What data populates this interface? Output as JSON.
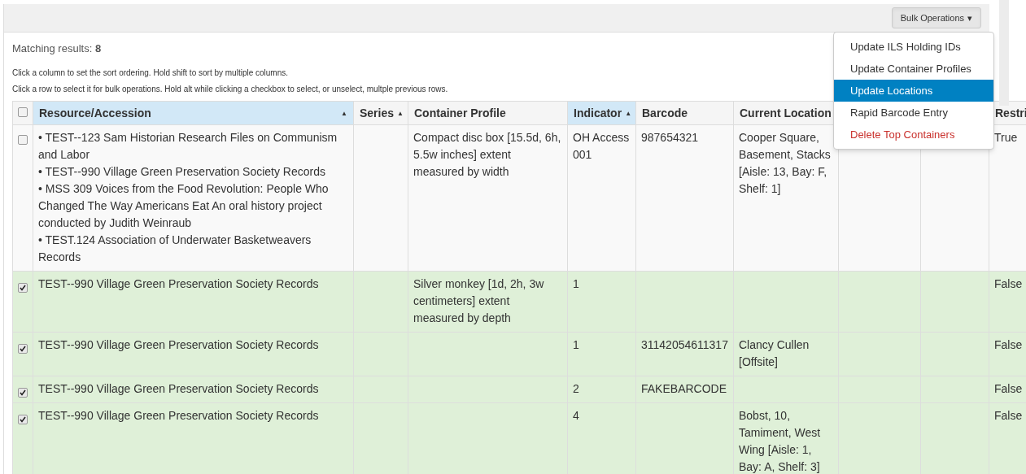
{
  "toolbar": {
    "bulk_button": {
      "label": "Bulk Operations",
      "caret": "▾",
      "expanded": true
    }
  },
  "bulk_menu": [
    {
      "label": "Update ILS Holding IDs",
      "kind": "action",
      "selected": false
    },
    {
      "label": "Update Container Profiles",
      "kind": "action",
      "selected": false
    },
    {
      "label": "Update Locations",
      "kind": "action",
      "selected": true
    },
    {
      "label": "Rapid Barcode Entry",
      "kind": "action",
      "selected": false
    },
    {
      "label": "Delete Top Containers",
      "kind": "danger",
      "selected": false
    }
  ],
  "results": {
    "label": "Matching results:",
    "count": "8"
  },
  "hints": [
    "Click a column to set the sort ordering. Hold shift to sort by multiple columns.",
    "Click a row to select it for bulk operations. Hold alt while clicking a checkbox to select, or unselect, multple previous rows."
  ],
  "table": {
    "select_all": {
      "checked": false
    },
    "columns": [
      {
        "label": "Resource/Accession",
        "sort_icon": "▲",
        "sorted": true
      },
      {
        "label": "Series",
        "sort_icon": "▲",
        "sorted": false
      },
      {
        "label": "Container Profile",
        "sorted": false
      },
      {
        "label": "Indicator",
        "sort_icon": "▲",
        "sorted": true
      },
      {
        "label": "Barcode",
        "sorted": false
      },
      {
        "label": "Current Location",
        "sorted": false
      },
      {},
      {},
      {
        "label": "Restri",
        "sorted": false
      }
    ],
    "rows": [
      {
        "selected": false,
        "resource": [
          "• TEST--123 Sam Historian Research Files on Communism and Labor",
          "• TEST--990 Village Green Preservation Society Records",
          "• MSS 309 Voices from the Food Revolution: People Who Changed The Way Americans Eat An oral history project conducted by Judith Weinraub",
          "• TEST.124 Association of Underwater Basketweavers Records"
        ],
        "container_profile": "Compact disc box [15.5d, 6h, 5.5w inches] extent measured by width",
        "indicator": "OH Access 001",
        "barcode": "987654321",
        "current_location": "Cooper Square, Basement, Stacks [Aisle: 13, Bay: F, Shelf: 1]",
        "restricted": "True"
      },
      {
        "selected": true,
        "resource": [
          "TEST--990 Village Green Preservation Society Records"
        ],
        "container_profile": "Silver monkey [1d, 2h, 3w centimeters] extent measured by depth",
        "indicator": "1",
        "restricted": "False"
      },
      {
        "selected": true,
        "resource": [
          "TEST--990 Village Green Preservation Society Records"
        ],
        "indicator": "1",
        "barcode": "31142054611317",
        "current_location": "Clancy Cullen [Offsite]",
        "restricted": "False"
      },
      {
        "selected": true,
        "resource": [
          "TEST--990 Village Green Preservation Society Records"
        ],
        "indicator": "2",
        "barcode": "FAKEBARCODE",
        "restricted": "False"
      },
      {
        "selected": true,
        "resource": [
          "TEST--990 Village Green Preservation Society Records"
        ],
        "indicator": "4",
        "current_location": "Bobst, 10, Tamiment, West Wing [Aisle: 1, Bay: A, Shelf: 3]",
        "restricted": "False"
      }
    ]
  }
}
